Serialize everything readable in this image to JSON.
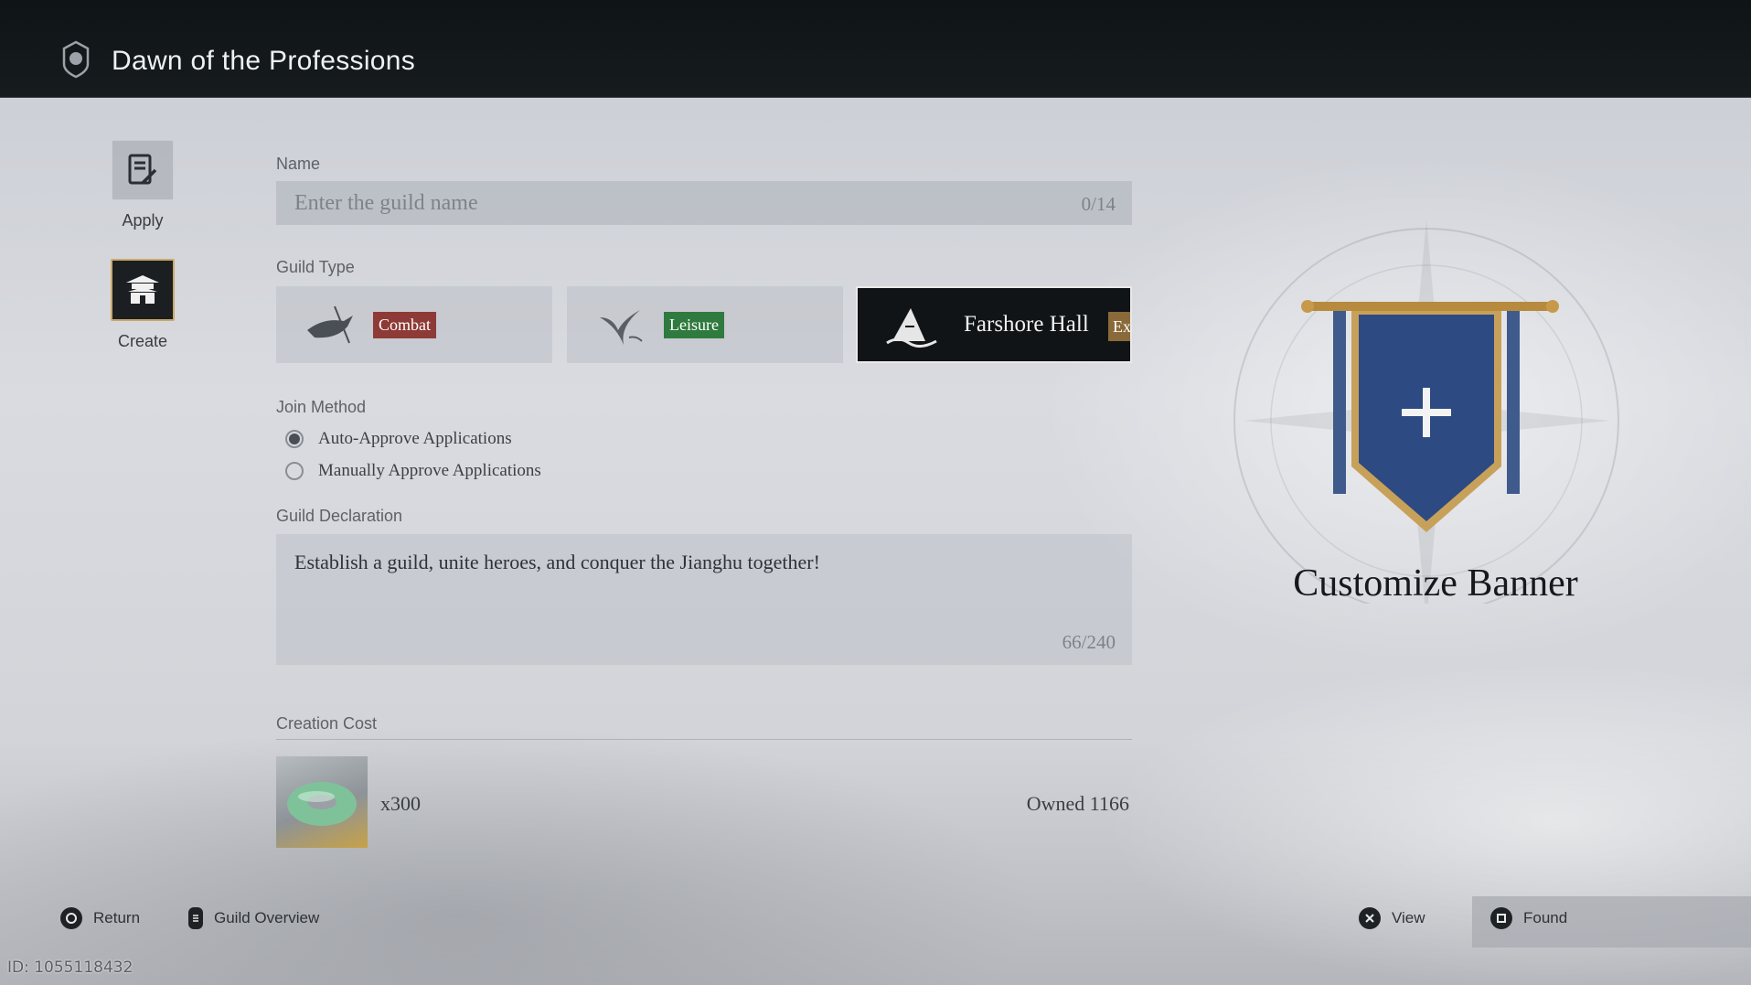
{
  "header": {
    "title": "Dawn of the Professions",
    "emblem_icon": "guild-emblem-icon"
  },
  "nav": [
    {
      "label": "Apply",
      "icon": "document-pen-icon"
    },
    {
      "label": "Create",
      "icon": "pagoda-icon"
    }
  ],
  "form": {
    "name_label": "Name",
    "name_placeholder": "Enter the guild name",
    "name_count": "0/14",
    "guild_type_label": "Guild Type",
    "guild_types": [
      {
        "badge": "Combat",
        "badge_color": "#8e3a36",
        "icon": "bird-sword-icon"
      },
      {
        "badge": "Leisure",
        "badge_color": "#2f7a3e",
        "icon": "bird-leaf-icon"
      },
      {
        "label": "Farshore Hall",
        "badge_cut": "Ex",
        "icon": "mountain-wave-icon",
        "selected": true
      }
    ],
    "join_method_label": "Join Method",
    "join_options": [
      {
        "label": "Auto-Approve Applications",
        "selected": true
      },
      {
        "label": "Manually Approve Applications",
        "selected": false
      }
    ],
    "declaration_label": "Guild Declaration",
    "declaration_text": "Establish a guild, unite heroes, and conquer the Jianghu together!",
    "declaration_count": "66/240",
    "creation_cost_label": "Creation Cost",
    "cost_item_icon": "jade-ring-icon",
    "cost_qty": "x300",
    "owned": "Owned 1166"
  },
  "banner": {
    "title": "Customize Banner",
    "icon": "banner-plus-icon"
  },
  "footer": {
    "return": "Return",
    "guild_overview": "Guild Overview",
    "view": "View",
    "found": "Found",
    "id": "ID: 1055118432"
  }
}
